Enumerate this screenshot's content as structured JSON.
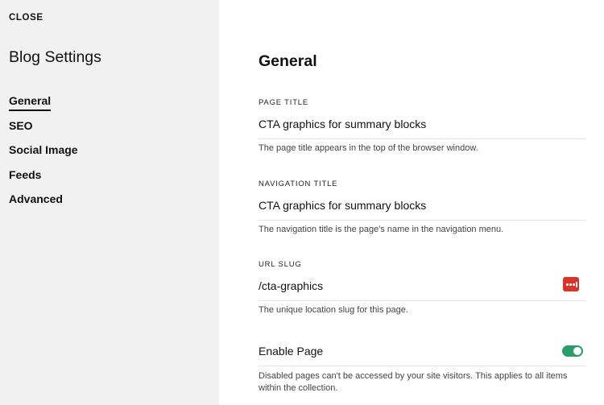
{
  "sidebar": {
    "close_label": "CLOSE",
    "title": "Blog Settings",
    "items": [
      {
        "label": "General",
        "active": true
      },
      {
        "label": "SEO",
        "active": false
      },
      {
        "label": "Social Image",
        "active": false
      },
      {
        "label": "Feeds",
        "active": false
      },
      {
        "label": "Advanced",
        "active": false
      }
    ]
  },
  "main": {
    "title": "General",
    "page_title": {
      "label": "PAGE TITLE",
      "value": "CTA graphics for summary blocks",
      "help": "The page title appears in the top of the browser window."
    },
    "navigation_title": {
      "label": "NAVIGATION TITLE",
      "value": "CTA graphics for summary blocks",
      "help": "The navigation title is the page's name in the navigation menu."
    },
    "url_slug": {
      "label": "URL SLUG",
      "value": "/cta-graphics",
      "help": "The unique location slug for this page.",
      "badge_icon": "password-manager-icon",
      "badge_color": "#d9342b"
    },
    "enable_page": {
      "label": "Enable Page",
      "enabled": true,
      "toggle_color": "#2d9c6b",
      "help": "Disabled pages can't be accessed by your site visitors. This applies to all items within the collection."
    }
  },
  "colors": {
    "sidebar_bg": "#f1f1f1",
    "main_bg": "#ffffff",
    "divider": "#e3e3e3"
  }
}
